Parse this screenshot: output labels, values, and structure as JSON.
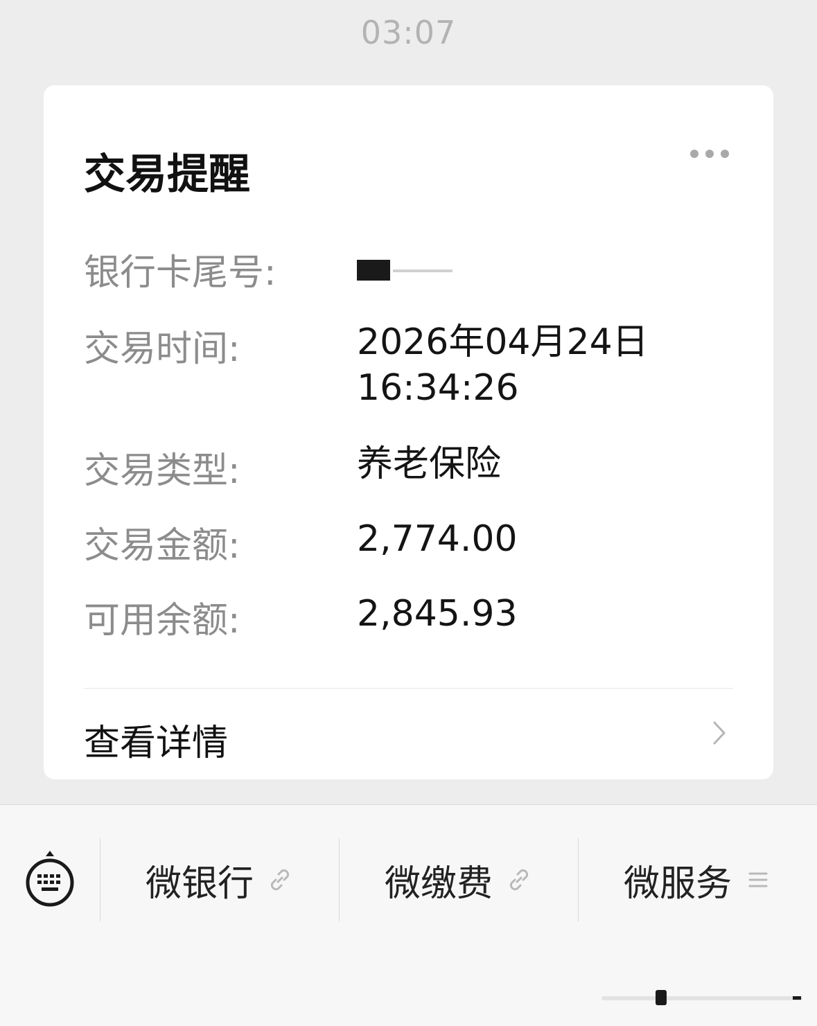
{
  "header": {
    "time": "03:07"
  },
  "card": {
    "title": "交易提醒",
    "rows": [
      {
        "label": "银行卡尾号:",
        "value": ""
      },
      {
        "label": "交易时间:",
        "value_line1": "2026年04月24日",
        "value_line2": "16:34:26"
      },
      {
        "label": "交易类型:",
        "value": "养老保险"
      },
      {
        "label": "交易金额:",
        "value": "2,774.00"
      },
      {
        "label": "可用余额:",
        "value": "2,845.93"
      }
    ],
    "details_label": "查看详情"
  },
  "menu": {
    "items": [
      {
        "label": "微银行",
        "icon": "link-icon"
      },
      {
        "label": "微缴费",
        "icon": "link-icon"
      },
      {
        "label": "微服务",
        "icon": "menu-lines-icon"
      }
    ]
  },
  "colors": {
    "background": "#ededed",
    "card": "#ffffff",
    "label": "#8c8c8c",
    "value": "#141414"
  }
}
